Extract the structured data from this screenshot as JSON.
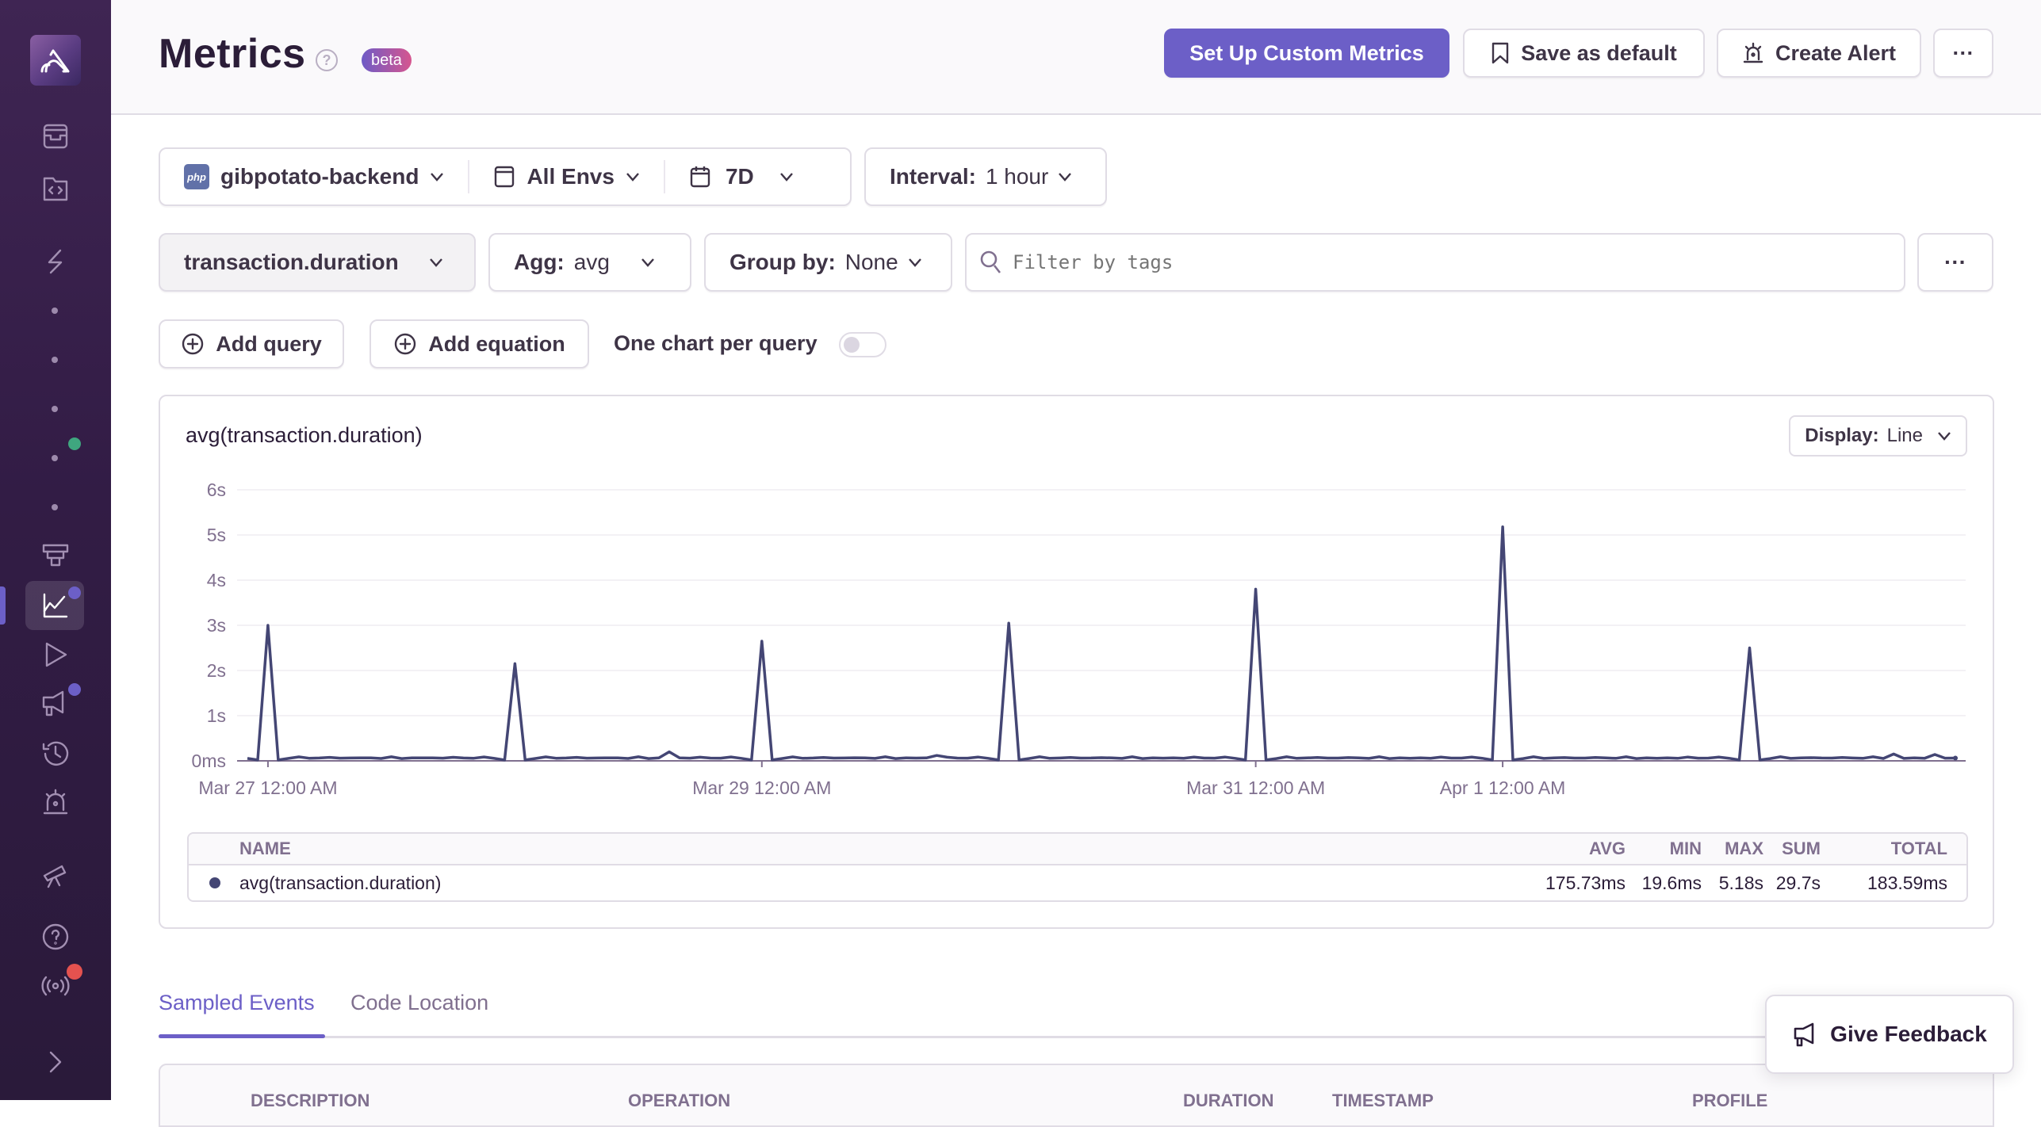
{
  "sidebar": {
    "logo": "sentry-logo",
    "items": [
      {
        "name": "issues",
        "icon": "inbox-icon"
      },
      {
        "name": "projects",
        "icon": "code-folder-icon"
      },
      {
        "name": "performance",
        "icon": "lightning-icon"
      },
      {
        "name": "dashboards",
        "icon": "dashboard-icon"
      },
      {
        "name": "metrics",
        "icon": "line-chart-icon",
        "active": true
      },
      {
        "name": "replays",
        "icon": "play-icon"
      },
      {
        "name": "user-feedback",
        "icon": "megaphone-icon"
      },
      {
        "name": "crons",
        "icon": "history-icon"
      },
      {
        "name": "alerts",
        "icon": "siren-icon"
      },
      {
        "name": "whats-new",
        "icon": "telescope-icon"
      },
      {
        "name": "help",
        "icon": "help-icon"
      },
      {
        "name": "service-status",
        "icon": "broadcast-icon"
      },
      {
        "name": "collapse",
        "icon": "chevron-right-icon"
      }
    ],
    "colors": {
      "green_badge": "#3fa67f",
      "purple_badge": "#6c5fc7",
      "red_badge": "#e5524f"
    }
  },
  "header": {
    "title": "Metrics",
    "badge": "beta",
    "buttons": {
      "setup": "Set Up Custom Metrics",
      "save_default": "Save as default",
      "create_alert": "Create Alert",
      "more": "···"
    }
  },
  "filters": {
    "project": "gibpotato-backend",
    "project_platform": "php",
    "environment": "All Envs",
    "period": "7D",
    "interval_label": "Interval:",
    "interval_value": "1 hour"
  },
  "query": {
    "metric": "transaction.duration",
    "agg_label": "Agg:",
    "agg_value": "avg",
    "group_label": "Group by:",
    "group_value": "None",
    "filter_placeholder": "Filter by tags",
    "more": "···"
  },
  "actions": {
    "add_query": "Add query",
    "add_equation": "Add equation",
    "one_chart_label": "One chart per query",
    "one_chart_enabled": false
  },
  "widget": {
    "title": "avg(transaction.duration)",
    "display_label": "Display:",
    "display_value": "Line",
    "legend": {
      "headers": {
        "name": "NAME",
        "avg": "AVG",
        "min": "MIN",
        "max": "MAX",
        "sum": "SUM",
        "total": "TOTAL"
      },
      "rows": [
        {
          "name": "avg(transaction.duration)",
          "color": "#444674",
          "avg": "175.73ms",
          "min": "19.6ms",
          "max": "5.18s",
          "sum": "29.7s",
          "total": "183.59ms"
        }
      ]
    }
  },
  "chart_data": {
    "type": "line",
    "title": "avg(transaction.duration)",
    "xlabel": "",
    "ylabel": "",
    "y_unit": "s",
    "ylim": [
      0,
      6
    ],
    "yticks": [
      "0ms",
      "1s",
      "2s",
      "3s",
      "4s",
      "5s",
      "6s"
    ],
    "xlim_hours": [
      -3,
      165
    ],
    "xticks": [
      {
        "hour": 0,
        "label": "Mar 27 12:00 AM"
      },
      {
        "hour": 48,
        "label": "Mar 29 12:00 AM"
      },
      {
        "hour": 96,
        "label": "Mar 31 12:00 AM"
      },
      {
        "hour": 120,
        "label": "Apr 1 12:00 AM"
      }
    ],
    "grid": true,
    "series": [
      {
        "name": "avg(transaction.duration)",
        "color": "#444674",
        "baseline_s": 0.05,
        "peaks": [
          {
            "hour": 0,
            "value": 3.0
          },
          {
            "hour": 24,
            "value": 2.15
          },
          {
            "hour": 48,
            "value": 2.65
          },
          {
            "hour": 72,
            "value": 3.05
          },
          {
            "hour": 96,
            "value": 3.8
          },
          {
            "hour": 120,
            "value": 5.18
          },
          {
            "hour": 144,
            "value": 2.5
          }
        ],
        "bumps": [
          {
            "hour": 38.5,
            "value": 0.2
          },
          {
            "hour": 65,
            "value": 0.12
          },
          {
            "hour": 158,
            "value": 0.15
          },
          {
            "hour": 162,
            "value": 0.14
          }
        ]
      }
    ]
  },
  "tabs": [
    {
      "label": "Sampled Events",
      "active": true
    },
    {
      "label": "Code Location",
      "active": false
    }
  ],
  "events_table": {
    "headers": [
      "DESCRIPTION",
      "OPERATION",
      "DURATION",
      "TIMESTAMP",
      "PROFILE"
    ]
  },
  "feedback": {
    "label": "Give Feedback"
  }
}
